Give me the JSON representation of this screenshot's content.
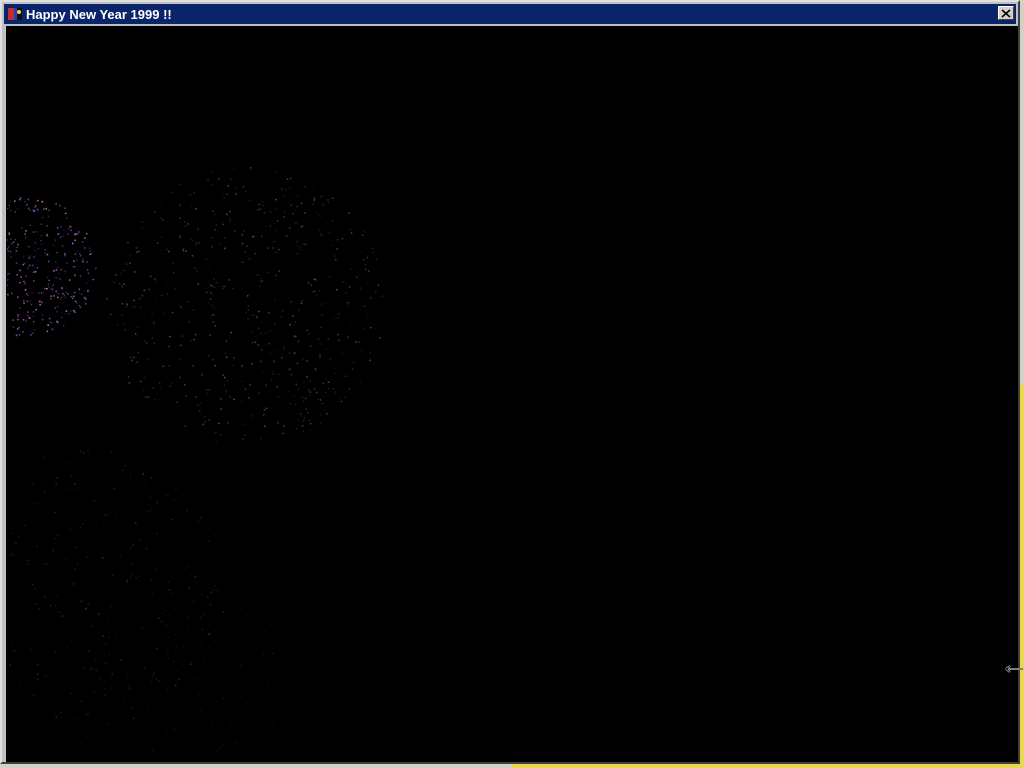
{
  "window": {
    "title": "Happy New Year 1999 !!",
    "app_icon": "app-icon",
    "close_icon": "close-icon"
  },
  "colors": {
    "titlebar": "#0a246a",
    "canvas_background": "#000000",
    "firework_pink": "#ff66cc",
    "firework_violet": "#9966ff",
    "firework_blue": "#4466ff",
    "desktop_accent": "#e8d84a"
  },
  "canvas": {
    "content": "fireworks animation"
  },
  "cursor": {
    "icon": "resize-horizontal-cursor-icon"
  }
}
